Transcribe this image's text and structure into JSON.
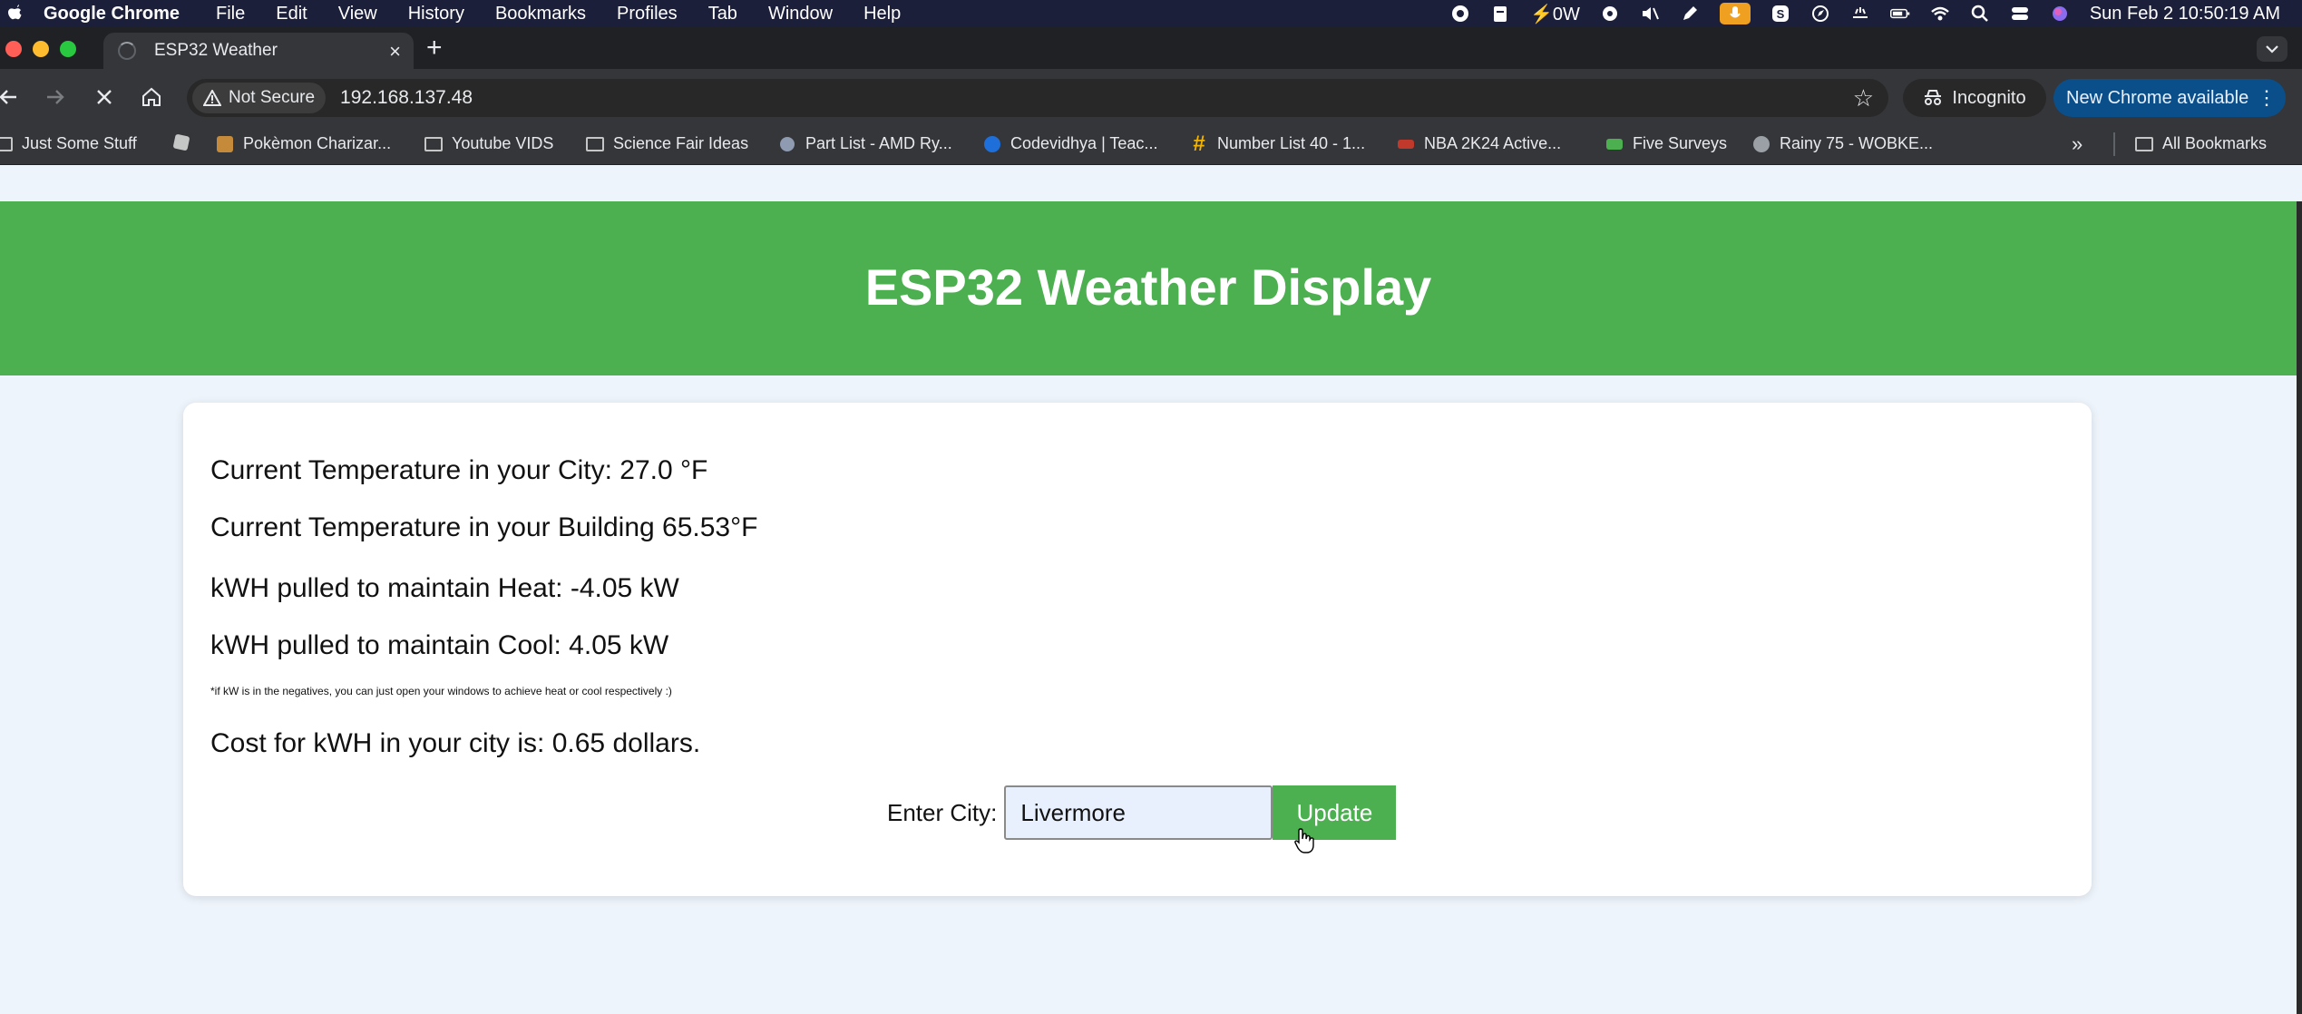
{
  "menubar": {
    "app_name": "Google Chrome",
    "items": [
      "File",
      "Edit",
      "View",
      "History",
      "Bookmarks",
      "Profiles",
      "Tab",
      "Window",
      "Help"
    ],
    "power_label": "0W",
    "datetime": "Sun Feb 2  10:50:19 AM"
  },
  "tab": {
    "title": "ESP32 Weather",
    "close_glyph": "×",
    "new_tab_glyph": "+"
  },
  "toolbar": {
    "security_label": "Not Secure",
    "url": "192.168.137.48",
    "incognito_label": "Incognito",
    "update_label": "New Chrome available"
  },
  "bookmarks": {
    "items": [
      {
        "label": "Just Some Stuff",
        "icon": "folder-icon"
      },
      {
        "label": "",
        "icon": "roblox-icon"
      },
      {
        "label": "Pokèmon Charizar...",
        "icon": "box-icon"
      },
      {
        "label": "Youtube VIDS",
        "icon": "folder-icon"
      },
      {
        "label": "Science Fair Ideas",
        "icon": "folder-icon"
      },
      {
        "label": "Part List - AMD Ry...",
        "icon": "parts-icon"
      },
      {
        "label": "Codevidhya | Teac...",
        "icon": "codevidhya-icon"
      },
      {
        "label": "Number List 40 - 1...",
        "icon": "hash-icon"
      },
      {
        "label": "NBA 2K24 Active...",
        "icon": "nba-icon"
      },
      {
        "label": "Five Surveys",
        "icon": "cash-icon"
      },
      {
        "label": "Rainy 75 - WOBKE...",
        "icon": "rainy-icon"
      }
    ],
    "all_bookmarks_label": "All Bookmarks"
  },
  "page": {
    "title": "ESP32 Weather Display",
    "city_temp": "Current Temperature in your City: 27.0 °F",
    "building_temp": "Current Temperature in your Building 65.53°F",
    "heat_kwh": "kWH pulled to maintain Heat: -4.05 kW",
    "cool_kwh": "kWH pulled to maintain Cool: 4.05 kW",
    "note": "*if kW is in the negatives, you can just open your windows to achieve heat or cool respectively :)",
    "cost": "Cost for kWH in your city is: 0.65 dollars.",
    "form": {
      "label": "Enter City:",
      "value": "Livermore",
      "button_label": "Update"
    }
  },
  "colors": {
    "header_green": "#4caf50",
    "page_bg": "#eef4fb",
    "chrome_dark": "#35363a",
    "menubar_bg": "#1b1f3a"
  }
}
